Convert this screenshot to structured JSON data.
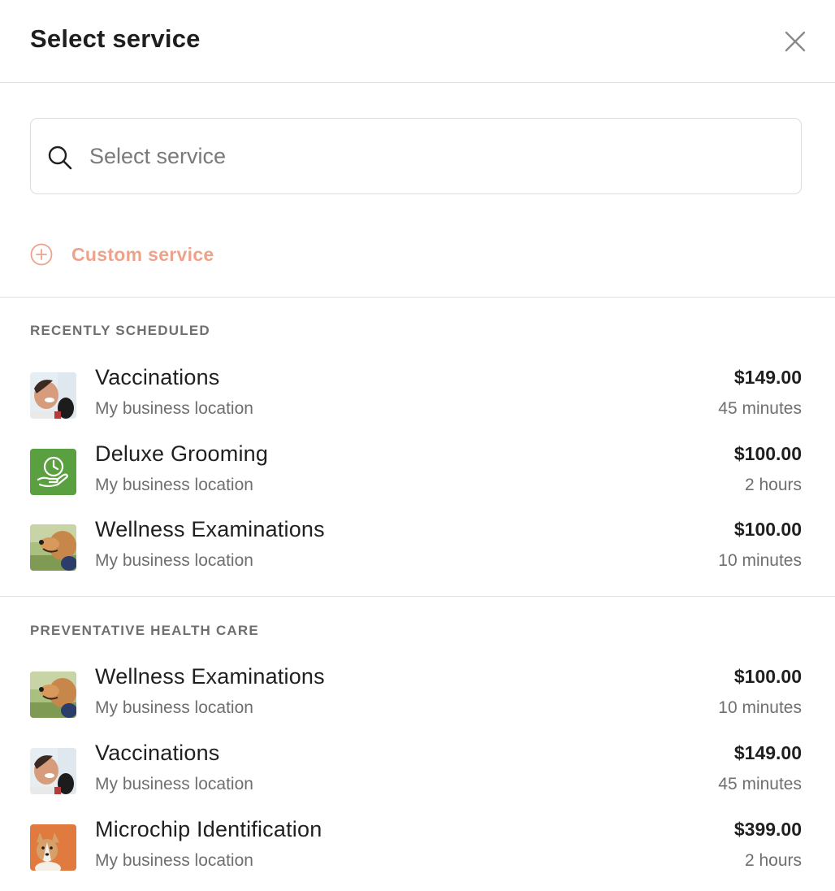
{
  "modal": {
    "title": "Select service",
    "close_icon": "close-icon"
  },
  "search": {
    "icon": "search-icon",
    "placeholder": "Select service",
    "value": ""
  },
  "custom_service": {
    "icon": "plus-circle-icon",
    "label": "Custom service",
    "color": "#eda38b"
  },
  "sections": [
    {
      "title": "RECENTLY SCHEDULED",
      "items": [
        {
          "name": "Vaccinations",
          "location": "My business location",
          "price": "$149.00",
          "duration": "45 minutes",
          "thumbnail": "vet-with-dog-photo"
        },
        {
          "name": "Deluxe Grooming",
          "location": "My business location",
          "price": "$100.00",
          "duration": "2 hours",
          "thumbnail": "clock-hand-icon"
        },
        {
          "name": "Wellness Examinations",
          "location": "My business location",
          "price": "$100.00",
          "duration": "10 minutes",
          "thumbnail": "dog-on-grass-photo"
        }
      ]
    },
    {
      "title": "PREVENTATIVE HEALTH CARE",
      "items": [
        {
          "name": "Wellness Examinations",
          "location": "My business location",
          "price": "$100.00",
          "duration": "10 minutes",
          "thumbnail": "dog-on-grass-photo"
        },
        {
          "name": "Vaccinations",
          "location": "My business location",
          "price": "$149.00",
          "duration": "45 minutes",
          "thumbnail": "vet-with-dog-photo"
        },
        {
          "name": "Microchip Identification",
          "location": "My business location",
          "price": "$399.00",
          "duration": "2 hours",
          "thumbnail": "corgi-photo"
        }
      ]
    }
  ],
  "colors": {
    "accent": "#eda38b",
    "grooming_icon_bg": "#5aa040",
    "text_primary": "#1f1f1f",
    "text_secondary": "#6f6f6f",
    "divider": "#e2e2e2"
  }
}
